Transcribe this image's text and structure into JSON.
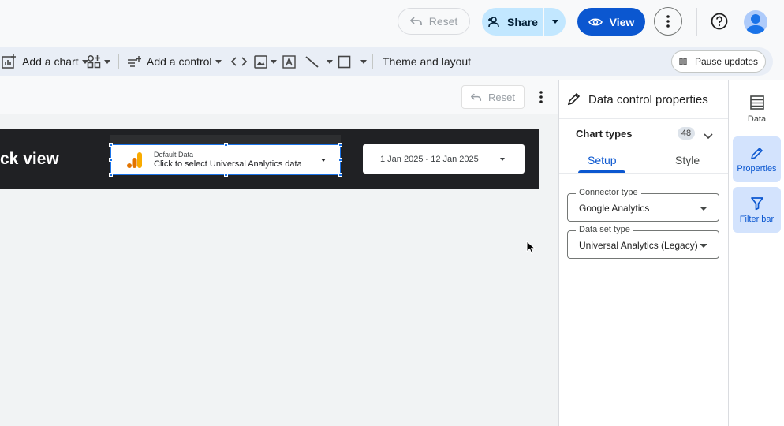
{
  "topbar": {
    "reset_label": "Reset",
    "share_label": "Share",
    "view_label": "View"
  },
  "toolbar": {
    "add_chart": "Add a chart",
    "add_control": "Add a control",
    "theme_layout": "Theme and layout",
    "pause_updates": "Pause updates"
  },
  "canvas": {
    "reset_label": "Reset",
    "report_title": "ck view",
    "data_control": {
      "small_label": "Default Data",
      "main_label": "Click to select Universal Analytics data"
    },
    "date_range": "1 Jan 2025 - 12 Jan 2025"
  },
  "properties": {
    "title": "Data control properties",
    "chart_types_label": "Chart types",
    "chart_types_count": "48",
    "tabs": [
      {
        "label": "Setup",
        "active": true
      },
      {
        "label": "Style",
        "active": false
      }
    ],
    "connector": {
      "label": "Connector type",
      "value": "Google Analytics"
    },
    "dataset": {
      "label": "Data set type",
      "value": "Universal Analytics (Legacy)"
    }
  },
  "rail": {
    "items": [
      {
        "label": "Data",
        "icon": "table-icon",
        "active": false
      },
      {
        "label": "Properties",
        "icon": "pencil-icon",
        "active": true
      },
      {
        "label": "Filter bar",
        "icon": "filter-icon",
        "active": true
      }
    ]
  },
  "colors": {
    "accent": "#0b57d0",
    "share_bg": "#c2e7ff",
    "header_bg": "#202124",
    "analytics_orange": "#f9ab00",
    "analytics_dark_orange": "#e37400"
  }
}
